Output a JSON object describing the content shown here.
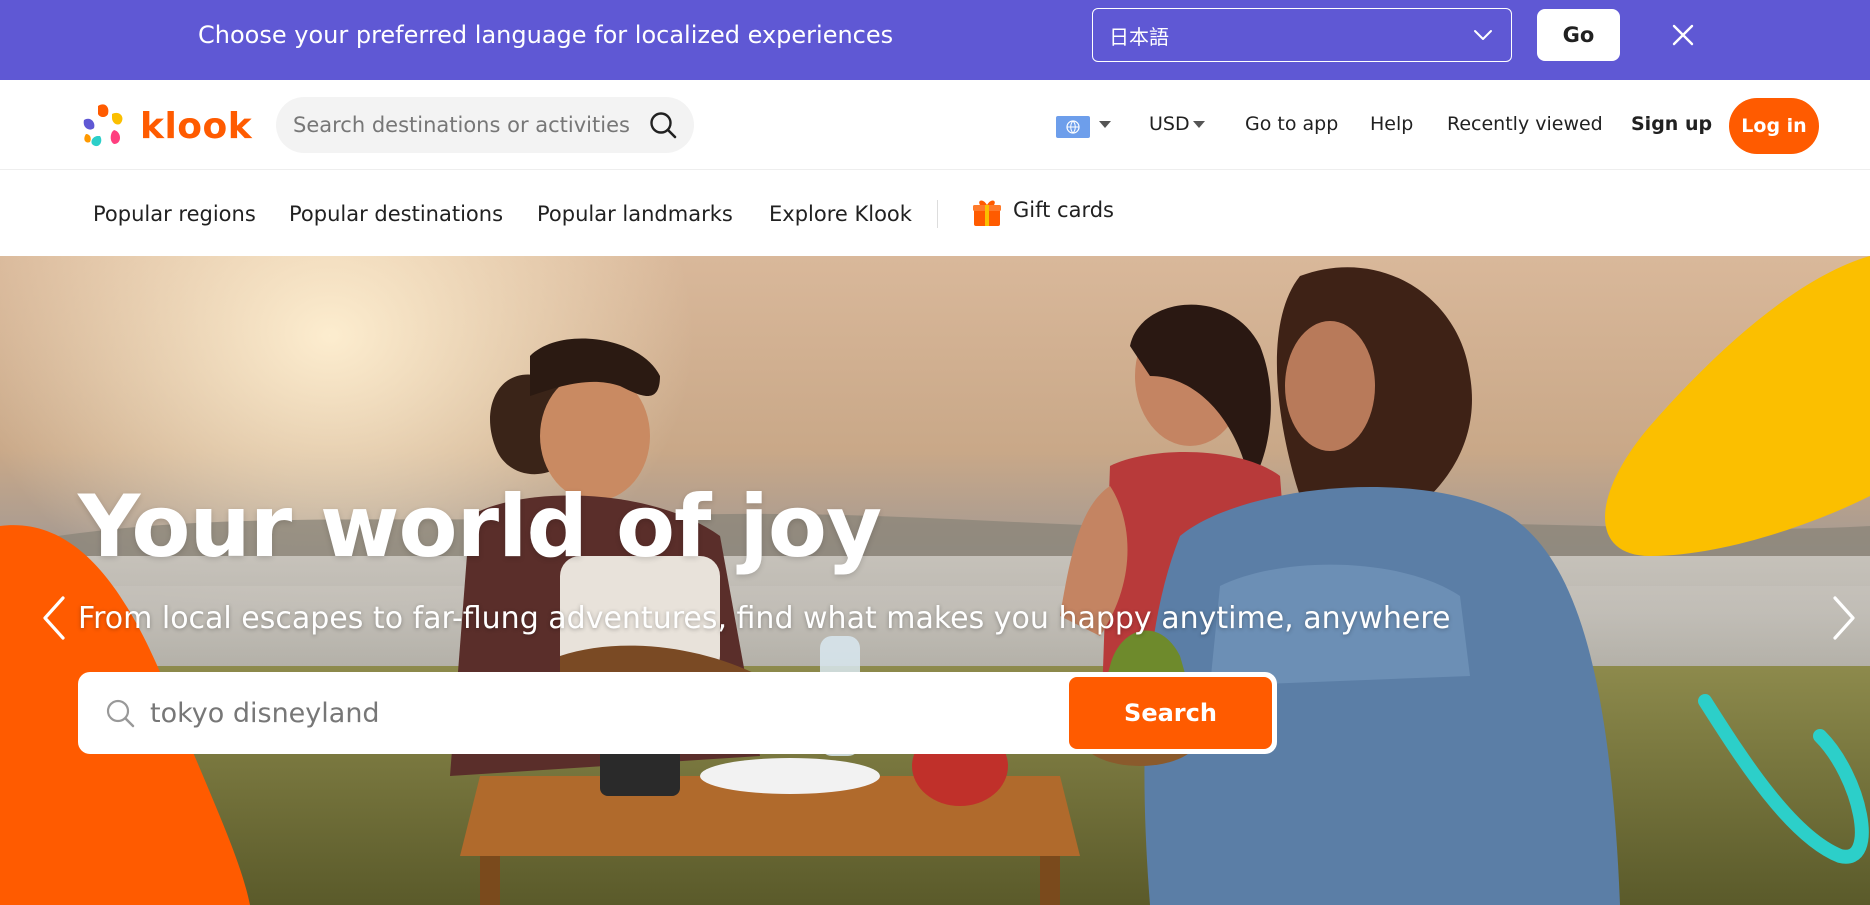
{
  "language_banner": {
    "message": "Choose your preferred language for localized experiences",
    "selected_language": "日本語",
    "go_label": "Go"
  },
  "header": {
    "logo_text": "klook",
    "search_placeholder": "Search destinations or activities",
    "currency": "USD",
    "go_to_app": "Go to app",
    "help": "Help",
    "recently_viewed": "Recently viewed",
    "sign_up": "Sign up",
    "log_in": "Log in"
  },
  "subnav": {
    "items": [
      "Popular regions",
      "Popular destinations",
      "Popular landmarks",
      "Explore Klook"
    ],
    "gift_cards": "Gift cards"
  },
  "hero": {
    "title": "Your world of joy",
    "subtitle": "From local escapes to far-flung adventures, find what makes you happy anytime, anywhere",
    "search_value": "tokyo disneyland",
    "search_button": "Search"
  },
  "colors": {
    "banner": "#5f58d4",
    "brand_orange": "#ff5b00",
    "accent_yellow": "#fbbf00",
    "accent_teal": "#2ccfc9"
  },
  "icons": [
    "chevron-down-icon",
    "close-icon",
    "klook-logo-icon",
    "search-icon",
    "globe-icon",
    "caret-down-icon",
    "gift-icon",
    "arrow-left-icon",
    "arrow-right-icon"
  ]
}
